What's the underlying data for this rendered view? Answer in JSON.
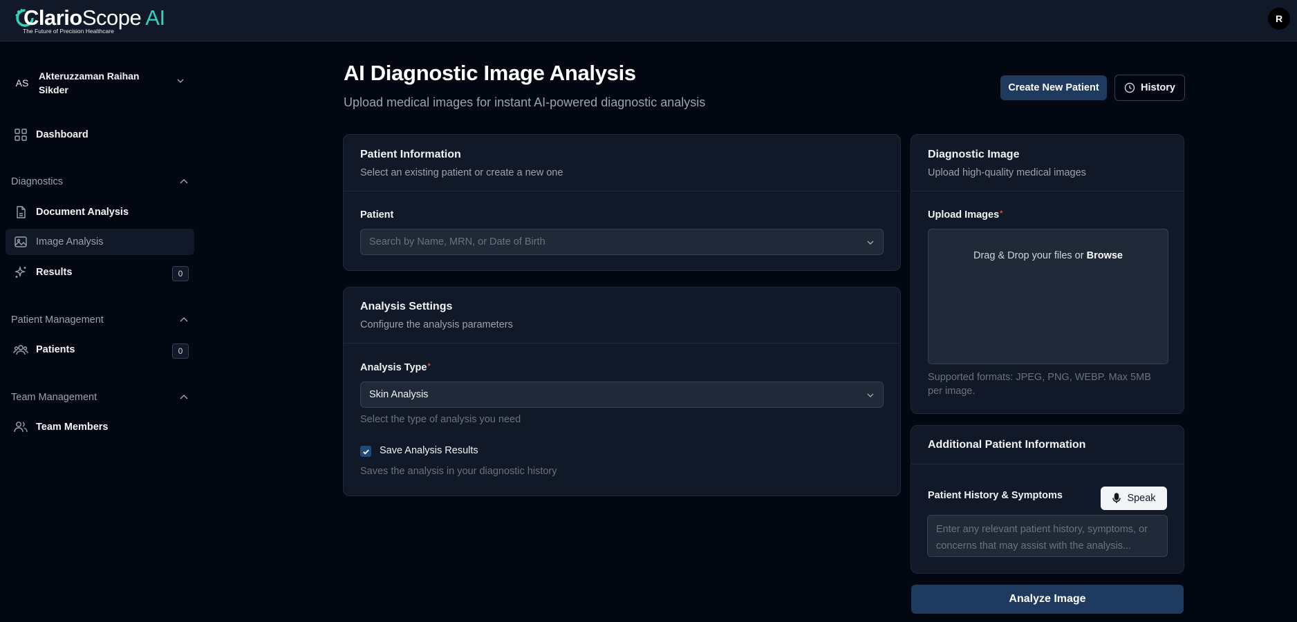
{
  "brand": {
    "name_part1": "Clario",
    "name_part2": "Scope",
    "name_part3": "AI",
    "tagline": "The Future of Precision Healthcare",
    "accent": "#2dd4bf"
  },
  "user": {
    "avatar_letter": "R"
  },
  "sidebar": {
    "profile": {
      "initials": "AS",
      "name": "Akteruzzaman Raihan Sikder"
    },
    "dashboard": {
      "label": "Dashboard",
      "icon": "grid-icon"
    },
    "groups": {
      "diagnostics": "Diagnostics",
      "patient_management": "Patient Management",
      "team_management": "Team Management"
    },
    "items": {
      "document_analysis": {
        "label": "Document Analysis",
        "icon": "file-icon"
      },
      "image_analysis": {
        "label": "Image Analysis",
        "icon": "image-icon"
      },
      "results": {
        "label": "Results",
        "icon": "sparkles-icon",
        "count": "0"
      },
      "patients": {
        "label": "Patients",
        "icon": "users-icon",
        "count": "0"
      },
      "team_members": {
        "label": "Team Members",
        "icon": "team-icon"
      }
    }
  },
  "header": {
    "title": "AI Diagnostic Image Analysis",
    "subtitle": "Upload medical images for instant AI-powered diagnostic analysis",
    "create_patient_label": "Create New Patient",
    "history_label": "History"
  },
  "patient_info": {
    "title": "Patient Information",
    "description": "Select an existing patient or create a new one",
    "field_label": "Patient",
    "placeholder": "Search by Name, MRN, or Date of Birth"
  },
  "analysis_settings": {
    "title": "Analysis Settings",
    "description": "Configure the analysis parameters",
    "type_label": "Analysis Type",
    "type_value": "Skin Analysis",
    "type_helper": "Select the type of analysis you need",
    "save_label": "Save Analysis Results",
    "save_checked": true,
    "save_helper": "Saves the analysis in your diagnostic history"
  },
  "diagnostic_image": {
    "title": "Diagnostic Image",
    "description": "Upload high-quality medical images",
    "upload_label": "Upload Images",
    "drop_text": "Drag & Drop your files or",
    "browse_text": "Browse",
    "formats_line1": "Supported formats: JPEG, PNG, WEBP. Max 5MB",
    "formats_line2": "per image."
  },
  "additional_info": {
    "title": "Additional Patient Information",
    "field_label": "Patient History & Symptoms",
    "speak_label": "Speak",
    "placeholder": "Enter any relevant patient history, symptoms, or concerns that may assist with the analysis..."
  },
  "actions": {
    "analyze_label": "Analyze Image"
  },
  "colors": {
    "background": "#030712",
    "card": "#111827",
    "primary_button": "#1e3a5f",
    "required": "#ef4444"
  }
}
